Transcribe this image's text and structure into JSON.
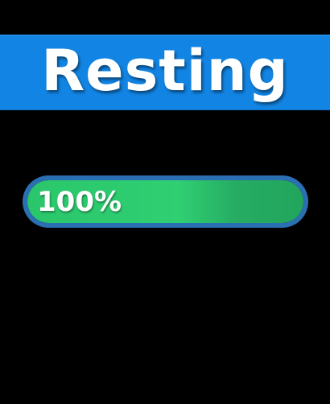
{
  "header": {
    "title": "Resting",
    "background_color": "#1284e3"
  },
  "progress": {
    "value_percent": 100,
    "label": "100%",
    "fill_color": "#2fcf72",
    "border_color": "#2b6fb3"
  }
}
